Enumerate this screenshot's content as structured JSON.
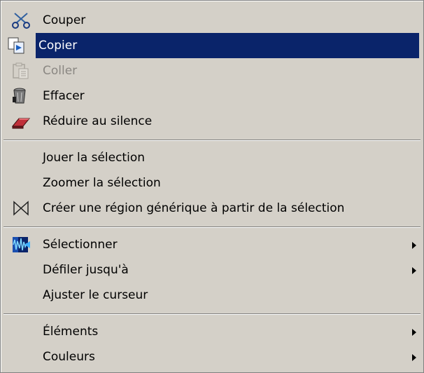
{
  "menu": {
    "items": [
      {
        "label": "Couper",
        "icon": "scissors-icon"
      },
      {
        "label": "Copier",
        "icon": "copy-icon"
      },
      {
        "label": "Coller",
        "icon": "paste-icon"
      },
      {
        "label": "Effacer",
        "icon": "trash-icon"
      },
      {
        "label": "Réduire au silence",
        "icon": "eraser-icon"
      },
      {
        "label": "Jouer la sélection"
      },
      {
        "label": "Zoomer la sélection"
      },
      {
        "label": "Créer une région générique à partir de la sélection",
        "icon": "bowtie-icon"
      },
      {
        "label": "Sélectionner",
        "icon": "waveform-select-icon"
      },
      {
        "label": "Défiler jusqu'à"
      },
      {
        "label": "Ajuster le curseur"
      },
      {
        "label": "Éléments"
      },
      {
        "label": "Couleurs"
      }
    ],
    "highlight_color": "#0a246a",
    "background_color": "#d4d0c8",
    "disabled_color": "#8a8782"
  }
}
